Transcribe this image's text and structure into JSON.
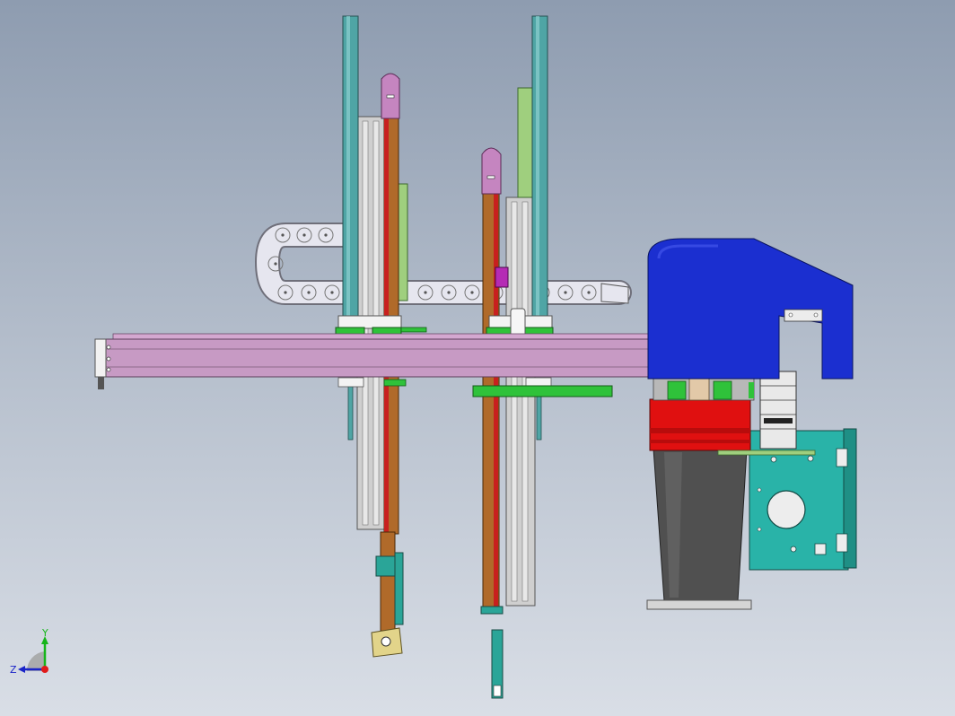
{
  "view": {
    "background_top": "#8e9cb0",
    "background_bottom": "#d9dee6"
  },
  "colors": {
    "column_teal": "#4fa5a5",
    "slide_pink": "#c585c0",
    "rail_brown": "#b06a2a",
    "rail_red": "#c8201e",
    "beam_lavender": "#c79ac4",
    "carriage_green": "#2fc23a",
    "guide_light_green": "#9fcf7e",
    "gripper_blue": "#1b2fd0",
    "block_red": "#e01010",
    "motor_dark": "#505050",
    "plate_cyan": "#29b3a8",
    "drag_chain": "#e6e6ef",
    "panel_grey": "#c9c9c9"
  },
  "triad": {
    "y_label": "Y",
    "z_label": "Z",
    "y_color": "#16b51a",
    "z_color": "#1a24c8",
    "origin_color": "#e01a1a"
  },
  "components": [
    "vertical-column-left",
    "vertical-column-right",
    "slide-unit-left",
    "slide-unit-right",
    "horizontal-beam",
    "cable-drag-chain",
    "gripper-head",
    "red-actuator-block",
    "motor-housing",
    "mounting-plate"
  ]
}
